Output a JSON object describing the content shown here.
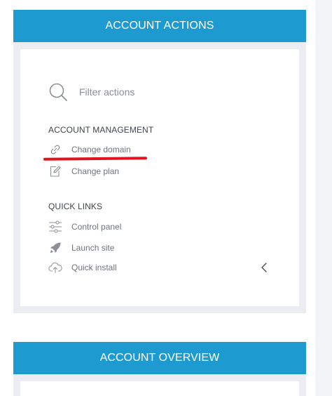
{
  "actions_panel": {
    "title": "ACCOUNT ACTIONS",
    "search": {
      "placeholder": "Filter actions",
      "value": ""
    },
    "sections": [
      {
        "title": "ACCOUNT MANAGEMENT",
        "items": [
          {
            "label": "Change domain",
            "icon": "link-icon"
          },
          {
            "label": "Change plan",
            "icon": "edit-icon"
          }
        ]
      },
      {
        "title": "QUICK LINKS",
        "items": [
          {
            "label": "Control panel",
            "icon": "sliders-icon"
          },
          {
            "label": "Launch site",
            "icon": "rocket-icon"
          },
          {
            "label": "Quick install",
            "icon": "cloud-upload-icon"
          }
        ]
      }
    ],
    "collapse_icon": "chevron-left-icon"
  },
  "overview_panel": {
    "title": "ACCOUNT OVERVIEW"
  },
  "colors": {
    "header_blue": "#1d9bd1",
    "panel_gray": "#ebedf3",
    "highlight_red": "#e0141e"
  }
}
